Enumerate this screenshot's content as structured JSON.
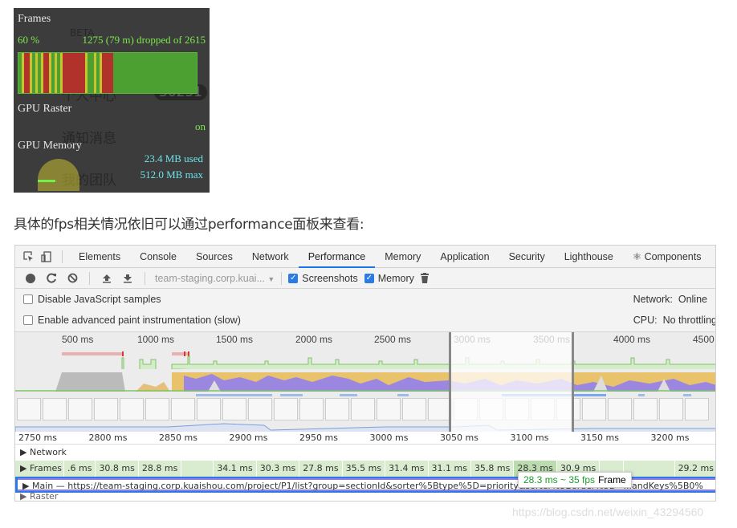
{
  "fps_meter": {
    "frames_label": "Frames",
    "percent": "60 %",
    "dropped_text": "1275 (79 m) dropped of 2615",
    "gpu_raster_label": "GPU Raster",
    "gpu_raster_status": "on",
    "gpu_memory_label": "GPU Memory",
    "memory_used": "23.4 MB used",
    "memory_max": "512.0 MB max",
    "gpu_memory_used_fraction": 0.046,
    "colors": {
      "good": "#4c9f31",
      "bad": "#b0322a",
      "partial": "#c8c42e"
    },
    "frame_segments": [
      "g",
      "y",
      "r",
      "y",
      "g",
      "y",
      "g",
      "y",
      "r",
      "y",
      "g",
      "y",
      "g",
      "y",
      "r",
      "r",
      "r",
      "r",
      "y",
      "g",
      "g",
      "y",
      "g",
      "y",
      "r",
      "r",
      "g",
      "g",
      "g",
      "g",
      "g"
    ],
    "background_text": {
      "beta": "BETA",
      "personal": "个人中心",
      "badge": "30251",
      "notify": "通知消息",
      "team": "我的团队"
    }
  },
  "caption": "具体的fps相关情况依旧可以通过performance面板来查看:",
  "devtools": {
    "tabs": [
      "Elements",
      "Console",
      "Sources",
      "Network",
      "Performance",
      "Memory",
      "Application",
      "Security",
      "Lighthouse",
      "⚛ Components"
    ],
    "active_tab": "Performance",
    "toolbar": {
      "url_select": "team-staging.corp.kuai...",
      "screenshots_label": "Screenshots",
      "screenshots_checked": true,
      "memory_label": "Memory",
      "memory_checked": true
    },
    "options": {
      "disable_js_samples": "Disable JavaScript samples",
      "advanced_paint": "Enable advanced paint instrumentation (slow)",
      "network_label": "Network:",
      "network_value": "Online",
      "cpu_label": "CPU:",
      "cpu_value": "No throttling"
    },
    "overview_ruler": [
      "500 ms",
      "1000 ms",
      "1500 ms",
      "2000 ms",
      "2500 ms",
      "3000 ms",
      "3500 ms",
      "4000 ms",
      "4500"
    ],
    "detail_ruler": [
      "2750 ms",
      "2800 ms",
      "2850 ms",
      "2900 ms",
      "2950 ms",
      "3000 ms",
      "3050 ms",
      "3100 ms",
      "3150 ms",
      "3200 ms"
    ],
    "tracks": {
      "network": "Network",
      "frames": "Frames",
      "main": "Main — https://team-staging.corp.kuaishou.com/project/P1/list?group=sectionId&sorter%5Btype%5D=priority&sorter%5Border%5D=...andKeys%5B0%",
      "raster": "Raster"
    },
    "frame_times": [
      ".6 ms",
      "30.8 ms",
      "28.8 ms",
      "",
      "34.1 ms",
      "30.3 ms",
      "27.8 ms",
      "35.5 ms",
      "31.4 ms",
      "31.1 ms",
      "35.8 ms",
      "28.3 ms",
      "30.9 ms",
      "",
      "",
      "29.2 ms"
    ],
    "tooltip": {
      "value": "28.3 ms ~ 35 fps",
      "label": "Frame"
    }
  },
  "footer_url": "https://blog.csdn.net/weixin_43294560"
}
